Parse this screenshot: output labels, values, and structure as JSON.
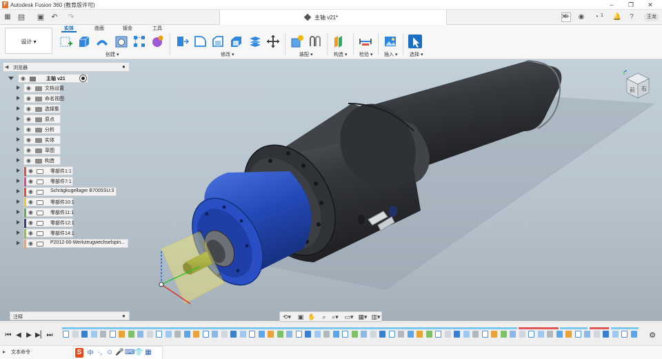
{
  "app": {
    "title": "Autodesk Fusion 360 (教育版许可)"
  },
  "document_tab": {
    "label": "主轴 v21*"
  },
  "top_right": {
    "notification_count": "1",
    "user_label": "王龙"
  },
  "toolbar": {
    "workspace": "设计 ▾",
    "tabs": [
      "实体",
      "曲面",
      "钣金",
      "工具"
    ],
    "groups": [
      "创建 ▾",
      "修改 ▾",
      "装配 ▾",
      "构造 ▾",
      "检验 ▾",
      "插入 ▾",
      "选择 ▾"
    ]
  },
  "browser": {
    "title": "浏览器",
    "root": "主轴 v21",
    "items": [
      {
        "label": "文档设置",
        "color": ""
      },
      {
        "label": "命名视图",
        "color": ""
      },
      {
        "label": "选择集",
        "color": ""
      },
      {
        "label": "原点",
        "color": ""
      },
      {
        "label": "分析",
        "color": ""
      },
      {
        "label": "实体",
        "color": ""
      },
      {
        "label": "草图",
        "color": ""
      },
      {
        "label": "构造",
        "color": ""
      },
      {
        "label": "零部件1:1",
        "color": "#d9534f"
      },
      {
        "label": "零部件7:1",
        "color": "#e04a8a"
      },
      {
        "label": "Schrägkugellager B7005SU:3",
        "color": "#e0533a"
      },
      {
        "label": "零部件10:1",
        "color": "#e8c53a"
      },
      {
        "label": "零部件11:1",
        "color": "#5bb35a"
      },
      {
        "label": "零部件12:1",
        "color": "#2d3f9a"
      },
      {
        "label": "零部件14:1",
        "color": "#8bc34a"
      },
      {
        "label": "P2012-00-Werkzeugwechselspin...",
        "color": "#f0a060"
      }
    ]
  },
  "annotations": {
    "label": "注释"
  },
  "status": {
    "command_label": "文本命令"
  },
  "colors": {
    "accent": "#1a6fc2",
    "motor_blue": "#2449b8",
    "body_dark": "#3a3d42"
  }
}
